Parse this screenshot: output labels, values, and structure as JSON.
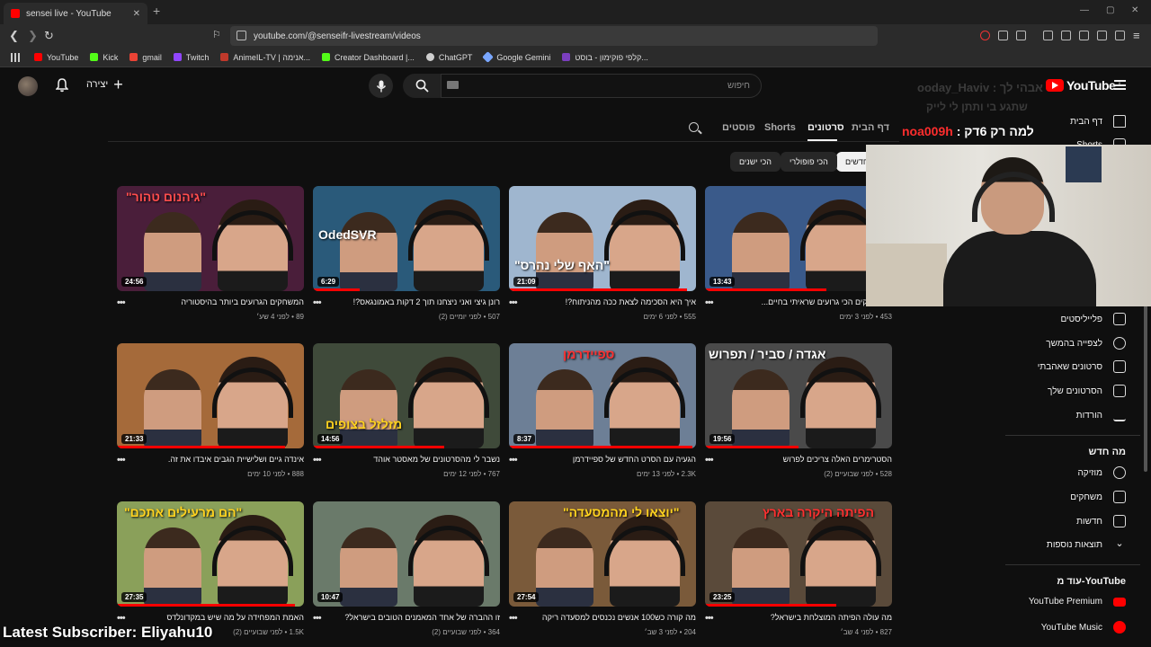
{
  "browser": {
    "tab_title": "sensei live - YouTube",
    "tab_close": "✕",
    "new_tab": "+",
    "url": "youtube.com/@senseifr-livestream/videos",
    "window_controls": [
      "—",
      "▢",
      "✕"
    ],
    "bookmarks": [
      {
        "label": "YouTube",
        "color": "#ff0000"
      },
      {
        "label": "Kick",
        "color": "#53fc18"
      },
      {
        "label": "gmail",
        "color": "#ea4335"
      },
      {
        "label": "Twitch",
        "color": "#9146ff"
      },
      {
        "label": "AnimeIL-TV | אנימה...",
        "color": "#c0392b"
      },
      {
        "label": "Creator Dashboard |...",
        "color": "#53fc18"
      },
      {
        "label": "ChatGPT",
        "color": "#cfcfcf"
      },
      {
        "label": "Google Gemini",
        "color": "#7aa7ff"
      },
      {
        "label": "קלפי פוקימון - בוסט...",
        "color": "#7b3fbf"
      }
    ]
  },
  "header": {
    "create_label": "יצירה",
    "search_placeholder": "חיפוש",
    "logo_text": "YouTube",
    "logo_country": "IL"
  },
  "sidebar": {
    "top_items": [
      {
        "label": "דף הבית",
        "icon": "home-icon"
      },
      {
        "label": "Shorts",
        "icon": "shorts-icon"
      }
    ],
    "library_items": [
      {
        "label": "פלייליסטים",
        "icon": "playlist-icon"
      },
      {
        "label": "לצפייה בהמשך",
        "icon": "clock-icon"
      },
      {
        "label": "סרטונים שאהבתי",
        "icon": "thumbs-up-icon"
      },
      {
        "label": "הסרטונים שלך",
        "icon": "your-videos-icon"
      },
      {
        "label": "הורדות",
        "icon": "download-icon"
      }
    ],
    "explore_title": "מה חדש",
    "explore_items": [
      {
        "label": "מוזיקה",
        "icon": "music-icon"
      },
      {
        "label": "משחקים",
        "icon": "gaming-icon"
      },
      {
        "label": "חדשות",
        "icon": "news-icon"
      },
      {
        "label": "תוצאות נוספות",
        "icon": "chevron-down-icon"
      }
    ],
    "more_title": "עוד מ-YouTube",
    "more_items": [
      {
        "label": "YouTube Premium",
        "icon": "youtube-premium-icon"
      },
      {
        "label": "YouTube Music",
        "icon": "youtube-music-icon"
      }
    ]
  },
  "channel_tabs": [
    "דף הבית",
    "סרטונים",
    "Shorts",
    "פוסטים"
  ],
  "active_tab": "סרטונים",
  "chips": [
    "הכי חדשים",
    "הכי פופולרי",
    "הכי ישנים"
  ],
  "videos": [
    {
      "title": "הטיקטוקים הכי גרועים שראיתי בחיים...",
      "views": "453",
      "age": "לפני 3 ימים",
      "duration": "13:43",
      "bg": "#3a5a8a",
      "overlay": "",
      "progress": 0.65
    },
    {
      "title": "איך היא הסכימה לצאת ככה מהניתוח?!",
      "views": "555",
      "age": "לפני 6 ימים",
      "duration": "21:09",
      "bg": "#9fb6cf",
      "overlay": "\"האף שלי נהרס\"",
      "progress": 0.95
    },
    {
      "title": "רונן גיצי ואני ניצחנו תוך 2 דקות באמונגאס?!",
      "views": "507",
      "age": "לפני יומיים (2)",
      "duration": "6:29",
      "bg": "#2a5a7a",
      "overlay": "OdedSVR",
      "progress": 0.25
    },
    {
      "title": "המשחקים הגרועים ביותר בהיסטוריה",
      "views": "89",
      "age": "לפני 4 שע׳",
      "duration": "24:56",
      "bg": "#4a1e3a",
      "overlay": "\"גיהנום טהור\"",
      "progress": 0.0
    },
    {
      "title": "הסטרימרים האלה צריכים לפרוש",
      "views": "528",
      "age": "לפני שבועיים (2)",
      "duration": "19:56",
      "bg": "#4a4a4a",
      "overlay": "אגדה / סביר / תפרוש",
      "progress": 0.5
    },
    {
      "title": "הגעיה עם הסרט החדש של ספיידרמן",
      "views": "2.3K",
      "age": "לפני 13 ימים",
      "duration": "8:37",
      "bg": "#6d7f96",
      "overlay": "ספיידרמן",
      "progress": 0.98
    },
    {
      "title": "נשבר לי מהסרטונים של מאסטר אוהד",
      "views": "767",
      "age": "לפני 12 ימים",
      "duration": "14:56",
      "bg": "#3f4a3a",
      "overlay": "מזלזל בצופים",
      "progress": 0.7
    },
    {
      "title": "אינדה גיים ושלישיית הגבים איבדו את זה.",
      "views": "888",
      "age": "לפני 10 ימים",
      "duration": "21:33",
      "bg": "#a56a3a",
      "overlay": "",
      "progress": 0.9
    },
    {
      "title": "מה עולה הפיתה המוצלחת בישראל?",
      "views": "827",
      "age": "לפני 4 שב׳",
      "duration": "23:25",
      "bg": "#5a4a3a",
      "overlay": "הפיתה היקרה בארץ",
      "progress": 0.7
    },
    {
      "title": "מה קורה כש100 אנשים נכנסים למסעדה ריקה",
      "views": "204",
      "age": "לפני 3 שב׳",
      "duration": "27:54",
      "bg": "#7a5a3a",
      "overlay": "\"יוצאו לי מהמסעדה\"",
      "progress": 0.0
    },
    {
      "title": "זו ההברה של אחד המאמנים הטובים בישראל?",
      "views": "364",
      "age": "לפני שבועיים (2)",
      "duration": "10:47",
      "bg": "#6a7a6a",
      "overlay": "",
      "progress": 0.0
    },
    {
      "title": "האמת המפחידה על מה שיש במקדונלדס",
      "views": "1.5K",
      "age": "לפני שבועיים (2)",
      "duration": "27:35",
      "bg": "#8aa05a",
      "overlay": "\"הם מרעילים אתכם\"",
      "progress": 0.95
    }
  ],
  "stream": {
    "chat_ghost_1": "אבהי לך : ooday_Haviv",
    "chat_ghost_2": "שתגע בי ותתן לי לייק",
    "chat_user": "noa009h",
    "chat_message": "למה רק 6דק :",
    "subscriber_text": "Latest Subscriber: Eliyahu10"
  }
}
